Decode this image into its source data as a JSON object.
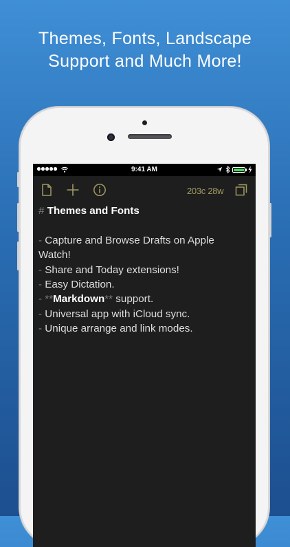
{
  "promo": {
    "line1": "Themes, Fonts, Landscape",
    "line2": "Support and Much More!"
  },
  "status_bar": {
    "time": "9:41 AM",
    "signal_bars": 5,
    "battery_color": "#4cd964"
  },
  "toolbar": {
    "icons": [
      "document-icon",
      "plus-icon",
      "info-icon",
      "arrange-icon"
    ],
    "char_count": "203c",
    "word_count": "28w",
    "accent": "#a19a63"
  },
  "draft": {
    "heading_marker": "#",
    "heading_text": "Themes and Fonts",
    "bullet_marker": "-",
    "bold_marker": "**",
    "items": [
      "Capture and Browse Drafts on Apple",
      "Watch!",
      "Share and Today extensions!",
      "Easy Dictation.",
      "Markdown",
      "support.",
      "Universal app with iCloud sync.",
      "Unique arrange and link modes."
    ]
  }
}
